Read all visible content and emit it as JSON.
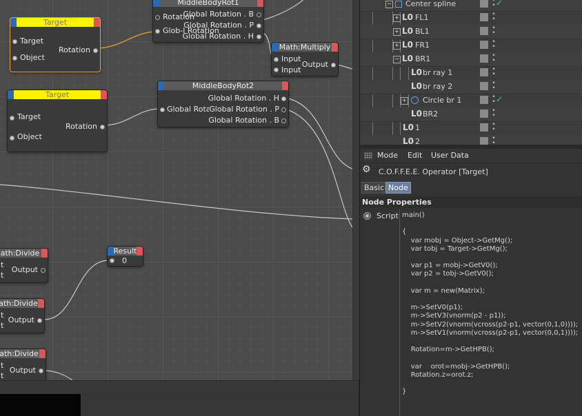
{
  "nodes": {
    "mbr1": {
      "title": "MiddleBodyRot1",
      "in": [
        "Rotation",
        "Glob-l Rotation"
      ],
      "out": [
        "Global Rotation . B",
        "Global Rotation . P",
        "Global Rotation . H"
      ]
    },
    "target1": {
      "title": "Target",
      "in": [
        "Target",
        "Object"
      ],
      "out": "Rotation"
    },
    "math_mult": {
      "title": "Math:Multiply",
      "in": [
        "Input",
        "Input"
      ],
      "out": "Output"
    },
    "target2": {
      "title": "Target",
      "in": [
        "Target",
        "Object"
      ],
      "out": "Rotation"
    },
    "mbr2": {
      "title": "MiddleBodyRot2",
      "in": "Global Rota",
      "out": [
        "Global Rotation . H",
        "Global Rotation . P",
        "Global Rotation . B"
      ]
    },
    "div1": {
      "title": "ath:Divide",
      "in": [
        "t",
        "t"
      ],
      "out": "Output"
    },
    "result": {
      "title": "Result",
      "value": "0"
    },
    "div2": {
      "title": "ath:Divide",
      "in": [
        "t",
        "t"
      ],
      "out": "Output"
    },
    "div3": {
      "title": "ath:Divide",
      "in": [
        "t",
        "t"
      ],
      "out": "Output"
    }
  },
  "tree": {
    "rows": [
      {
        "label": "Center spline",
        "check": true
      },
      {
        "label": "FL1"
      },
      {
        "label": "BL1"
      },
      {
        "label": "FR1"
      },
      {
        "label": "BR1"
      },
      {
        "label": "br ray 1"
      },
      {
        "label": "br ray 2"
      },
      {
        "label": "Circle br 1",
        "check": true
      },
      {
        "label": "BR2"
      },
      {
        "label": "1"
      },
      {
        "label": "2"
      }
    ],
    "null_glyph": "L0",
    "check_glyph": "✓",
    "accent": "#2fd36a"
  },
  "attributes": {
    "menu": [
      "Mode",
      "Edit",
      "User Data"
    ],
    "object_title": "C.O.F.F.E.E. Operator [Target]",
    "tabs": [
      "Basic",
      "Node"
    ],
    "active_tab": "Node",
    "section": "Node Properties",
    "script_label": "Script",
    "code": "main()\n\n{\n    var mobj = Object->GetMg();\n    var tobj = Target->GetMg();\n\n    var p1 = mobj->GetV0();\n    var p2 = tobj->GetV0();\n\n    var m = new(Matrix);\n\n    m->SetV0(p1);\n    m->SetV3(vnorm(p2 - p1));\n    m->SetV2(vnorm(vcross(p2-p1, vector(0,1,0))));\n    m->SetV1(vnorm(vcross(p2-p1, vector(0,0,1))));\n\n    Rotation=m->GetHPB();\n\n    var    orot=mobj->GetHPB();\n    Rotation.z=orot.z;\n\n}"
  },
  "colors": {
    "selection": "#e8a23c",
    "target_header": "#fdf200",
    "port_blue": "#2a6ab5",
    "port_red": "#d9575a",
    "active_tab": "#6a7fa0"
  }
}
